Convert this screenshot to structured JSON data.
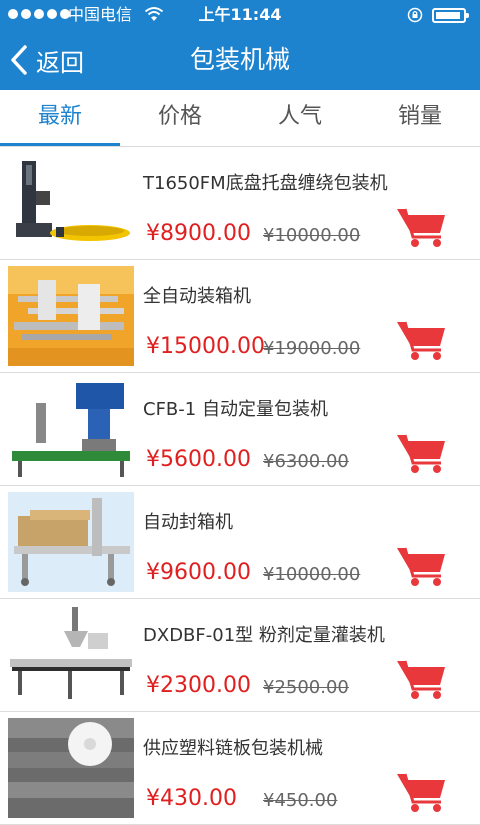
{
  "status_bar": {
    "carrier": "中国电信",
    "time": "上午11:44"
  },
  "nav": {
    "back_label": "返回",
    "title": "包装机械"
  },
  "tabs": [
    {
      "label": "最新",
      "active": true
    },
    {
      "label": "价格",
      "active": false
    },
    {
      "label": "人气",
      "active": false
    },
    {
      "label": "销量",
      "active": false
    }
  ],
  "products": [
    {
      "title": "T1650FM底盘托盘缠绕包装机",
      "price": "¥8900.00",
      "old_price": "¥10000.00",
      "image": "pallet-wrapping-machine"
    },
    {
      "title": "全自动装箱机",
      "price": "¥15000.00",
      "old_price": "¥19000.00",
      "image": "automatic-case-packer"
    },
    {
      "title": "CFB-1 自动定量包装机",
      "price": "¥5600.00",
      "old_price": "¥6300.00",
      "image": "quantitative-packing-machine"
    },
    {
      "title": "自动封箱机",
      "price": "¥9600.00",
      "old_price": "¥10000.00",
      "image": "carton-sealing-machine"
    },
    {
      "title": "DXDBF-01型 粉剂定量灌装机",
      "price": "¥2300.00",
      "old_price": "¥2500.00",
      "image": "powder-filling-machine"
    },
    {
      "title": "供应塑料链板包装机械",
      "price": "¥430.00",
      "old_price": "¥450.00",
      "image": "plastic-chain-plate"
    }
  ],
  "colors": {
    "primary": "#1e83cf",
    "price": "#e02020",
    "cart": "#e8383b"
  },
  "icons": {
    "back": "chevron-left-icon",
    "cart": "shopping-cart-icon",
    "wifi": "wifi-icon",
    "lock": "orientation-lock-icon",
    "battery": "battery-icon"
  }
}
